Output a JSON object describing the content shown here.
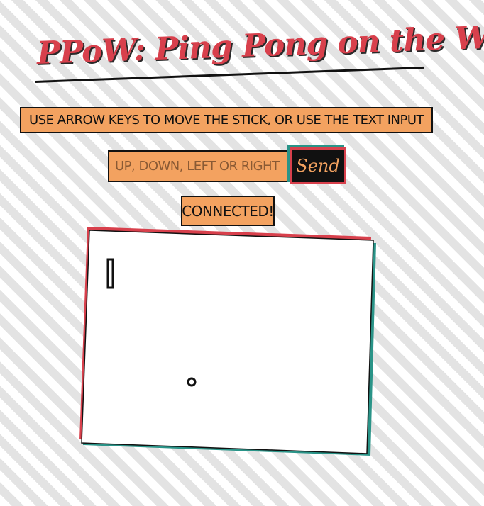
{
  "header": {
    "title": "PPoW: Ping Pong on the Web"
  },
  "instructions": {
    "text": "Use arrow keys to move the stick, or use the text input"
  },
  "controls": {
    "input_placeholder": "up, down, left or right",
    "input_value": "",
    "send_label": "Send"
  },
  "status": {
    "text": "Connected!"
  },
  "game": {
    "paddle_icon": "paddle",
    "ball_icon": "ball"
  },
  "colors": {
    "accent_red": "#d8404c",
    "accent_teal": "#2a9488",
    "accent_orange": "#f3a260",
    "ink": "#111111"
  }
}
